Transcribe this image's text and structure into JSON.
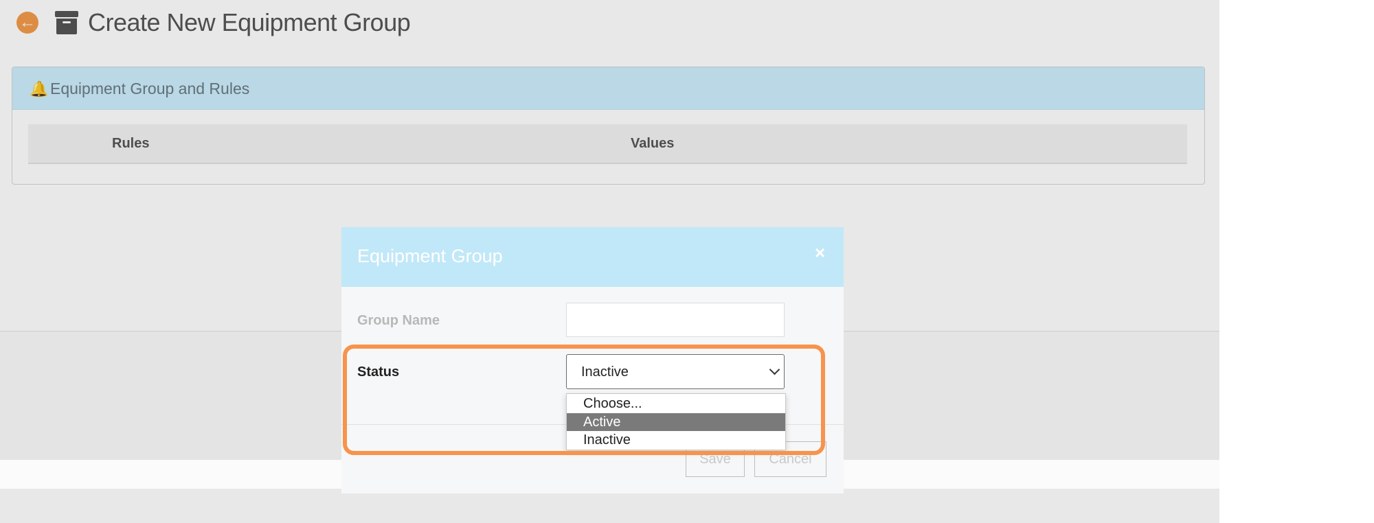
{
  "page": {
    "title": "Create New Equipment Group",
    "back_icon": "arrow-left-circle-icon",
    "title_icon": "archive-box-icon"
  },
  "panel": {
    "title": "Equipment Group and Rules",
    "icon": "bell-icon",
    "columns": [
      "Rules",
      "Values"
    ]
  },
  "modal": {
    "title": "Equipment Group",
    "close_label": "×",
    "fields": {
      "group_name_label": "Group Name",
      "group_name_value": "",
      "status_label": "Status",
      "status_value": "Inactive"
    },
    "status_options": [
      "Choose...",
      "Active",
      "Inactive"
    ],
    "highlighted_option": "Active",
    "buttons": {
      "save": "Save",
      "cancel": "Cancel"
    }
  },
  "colors": {
    "accent_orange": "#f7934c",
    "header_blue": "#c1e8f8",
    "option_highlight": "#7a7a7a"
  }
}
